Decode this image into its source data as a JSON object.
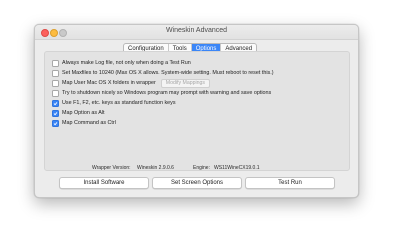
{
  "window": {
    "title": "Wineskin Advanced"
  },
  "tabs": [
    {
      "label": "Configuration",
      "active": false
    },
    {
      "label": "Tools",
      "active": false
    },
    {
      "label": "Options",
      "active": true
    },
    {
      "label": "Advanced",
      "active": false
    }
  ],
  "options": [
    {
      "label": "Always make Log file, not only when doing a Test Run",
      "checked": false
    },
    {
      "label": "Set Maxfiles to 10240 (Max OS X allows.  System-wide setting.  Must reboot to reset this.)",
      "checked": false
    },
    {
      "label": "Map User Mac OS X folders in wrapper",
      "checked": false
    },
    {
      "label": "Try to shutdown nicely so Windows program may prompt with warning and save options",
      "checked": false
    },
    {
      "label": "Use F1, F2, etc. keys as standard function keys",
      "checked": true
    },
    {
      "label": "Map Option as Alt",
      "checked": true
    },
    {
      "label": "Map Command as Ctrl",
      "checked": true
    }
  ],
  "modify_mappings_label": "Modify Mappings",
  "versions": {
    "wrapper_label": "Wrapper Version:",
    "wrapper_value": "Wineskin 2.9.0.6",
    "engine_label": "Engine:",
    "engine_value": "WS11WineCX19.0.1"
  },
  "buttons": {
    "install_software": "Install Software",
    "set_screen_options": "Set Screen Options",
    "test_run": "Test Run"
  },
  "colors": {
    "accent": "#3b86f7",
    "window_bg": "#ececec",
    "close": "#fc605c",
    "minimize": "#fdbc40"
  }
}
